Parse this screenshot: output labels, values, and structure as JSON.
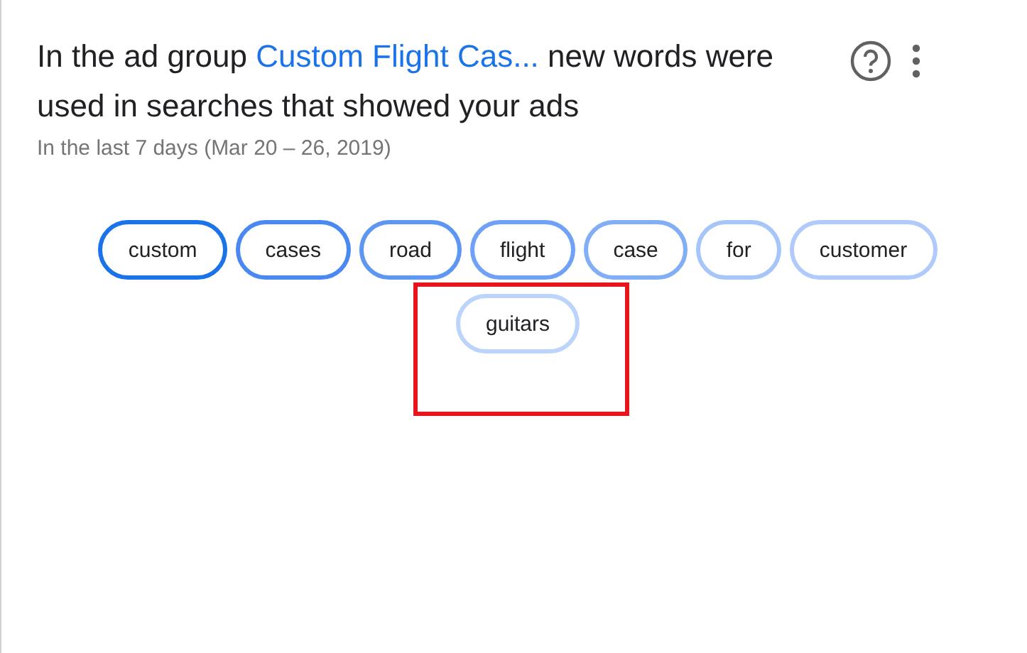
{
  "card": {
    "title_before": "In the ad group",
    "ad_group": "Custom Flight Cas...",
    "title_after": "new words were used in searches that showed your ads",
    "subtitle": "In the last 7 days (Mar 20 – 26, 2019)"
  },
  "words": [
    {
      "text": "custom",
      "color": "#1a73e8",
      "highlighted": false
    },
    {
      "text": "cases",
      "color": "#4a8af0",
      "highlighted": false
    },
    {
      "text": "road",
      "color": "#5d97f2",
      "highlighted": false
    },
    {
      "text": "flight",
      "color": "#6fa2f4",
      "highlighted": false
    },
    {
      "text": "case",
      "color": "#82aef5",
      "highlighted": false
    },
    {
      "text": "for",
      "color": "#a6c5f8",
      "highlighted": false
    },
    {
      "text": "customer",
      "color": "#b0cbf9",
      "highlighted": false
    },
    {
      "text": "guitars",
      "color": "#bcd3fa",
      "highlighted": true
    }
  ]
}
